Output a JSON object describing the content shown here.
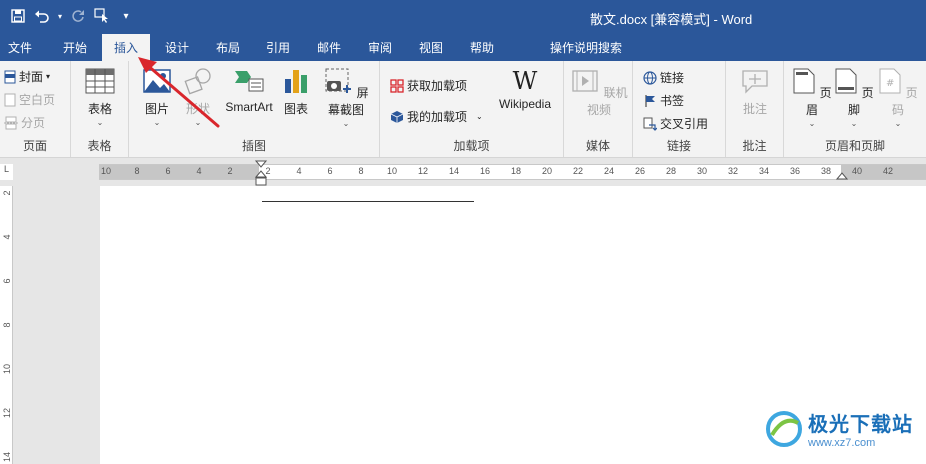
{
  "window": {
    "title": "散文.docx [兼容模式]  -  Word"
  },
  "quick_access": {
    "save_icon": "save-icon",
    "undo_icon": "undo-icon",
    "redo_icon": "redo-icon",
    "touch_icon": "touch-mode-icon",
    "customize_icon": "customize-icon"
  },
  "tabs": {
    "file": "文件",
    "home": "开始",
    "insert": "插入",
    "design": "设计",
    "layout": "布局",
    "references": "引用",
    "mailings": "邮件",
    "review": "审阅",
    "view": "视图",
    "help": "帮助",
    "tell_me": "操作说明搜索"
  },
  "ribbon": {
    "pages": {
      "label": "页面",
      "cover": "封面",
      "blank": "空白页",
      "break": "分页"
    },
    "tables": {
      "label": "表格",
      "table": "表格"
    },
    "illustrations": {
      "label": "插图",
      "picture": "图片",
      "shapes": "形状",
      "smartart": "SmartArt",
      "chart": "图表",
      "screenshot": "屏幕截图"
    },
    "addins": {
      "label": "加载项",
      "get": "获取加载项",
      "mine": "我的加载项",
      "wikipedia": "Wikipedia"
    },
    "media": {
      "label": "媒体",
      "video": "联机视频"
    },
    "links": {
      "label": "链接",
      "link": "链接",
      "bookmark": "书签",
      "xref": "交叉引用"
    },
    "comments": {
      "label": "批注",
      "comment": "批注"
    },
    "header_footer": {
      "label": "页眉和页脚",
      "header": "页眉",
      "footer": "页脚",
      "page_number": "页码"
    }
  },
  "ruler": {
    "corner": "L",
    "h_ticks": [
      "10",
      "8",
      "6",
      "4",
      "2",
      "2",
      "4",
      "6",
      "8",
      "10",
      "12",
      "14",
      "16",
      "18",
      "20",
      "22",
      "24",
      "26",
      "28",
      "30",
      "32",
      "34",
      "36",
      "38",
      "40",
      "42"
    ],
    "v_ticks": [
      "2",
      "4",
      "6",
      "8",
      "10",
      "12",
      "14"
    ]
  },
  "watermark": {
    "main": "极光下载站",
    "sub": "www.xz7.com"
  },
  "colors": {
    "title_bar": "#2b579a",
    "ribbon": "#f3f3f3",
    "annotation_arrow": "#d9262c"
  }
}
